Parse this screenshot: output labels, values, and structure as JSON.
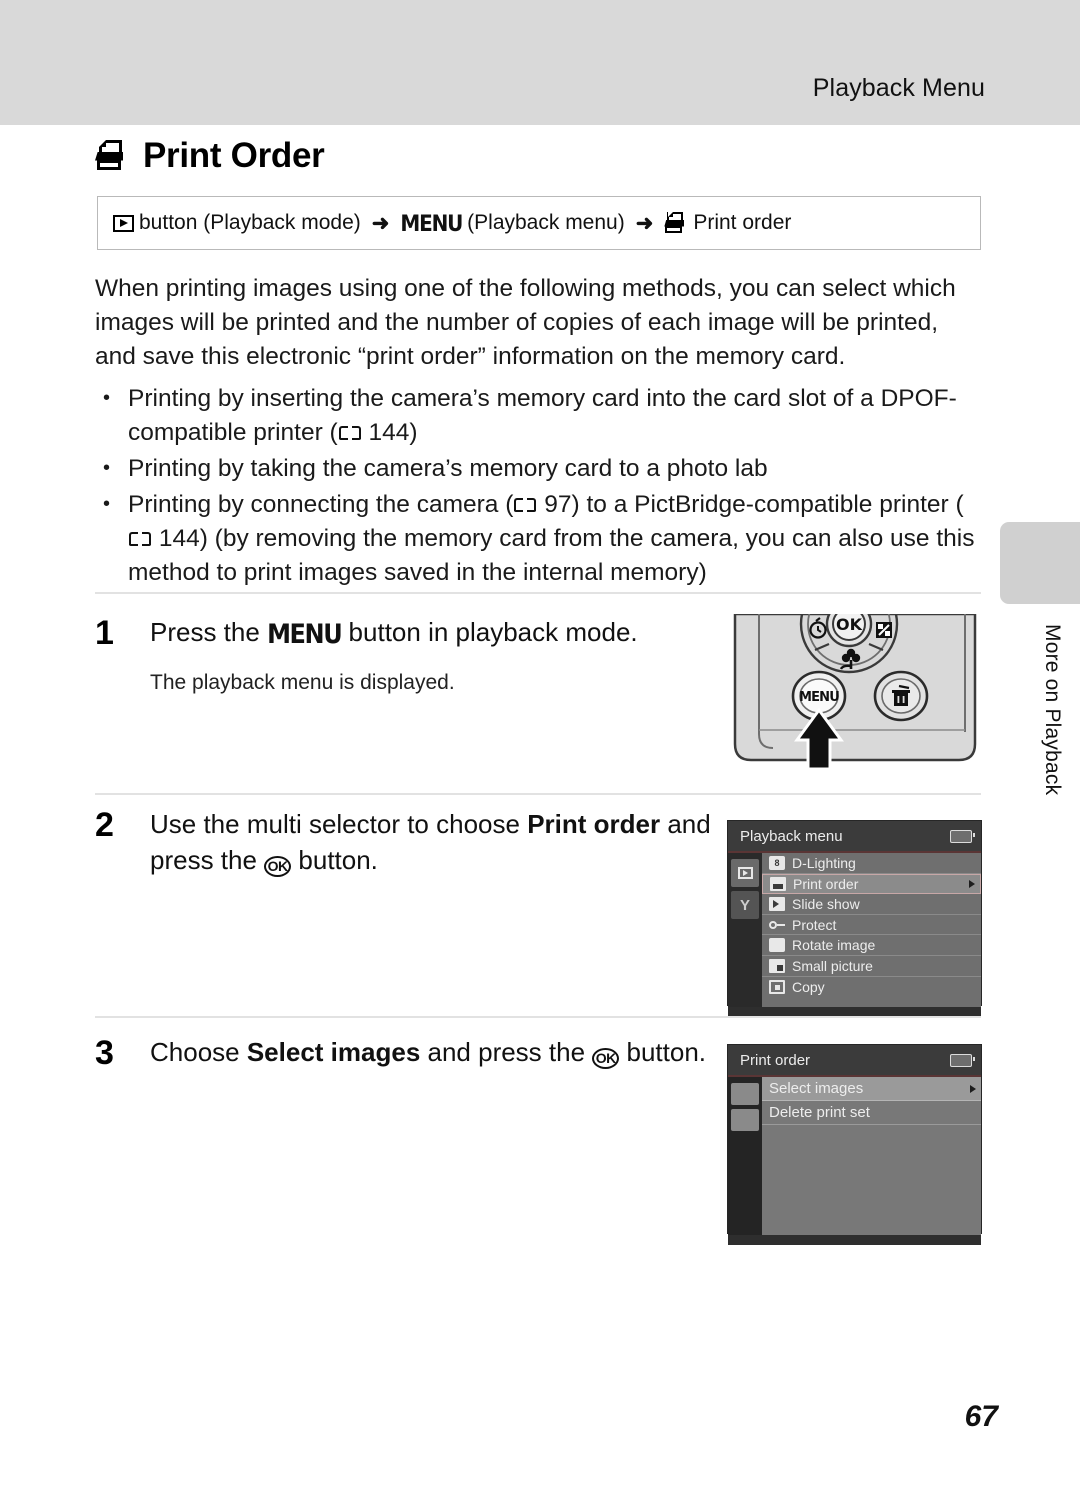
{
  "header": {
    "running_title": "Playback Menu"
  },
  "section": {
    "icon": "printer-icon",
    "title": "Print Order"
  },
  "path_box": {
    "play_icon": "playback-button-icon",
    "seg1": "button (Playback mode)",
    "arrow1": "➜",
    "menu_icon": "MENU",
    "seg2": "(Playback menu)",
    "arrow2": "➜",
    "printer_icon": "printer-icon",
    "seg3": "Print order"
  },
  "intro": {
    "paragraph": "When printing images using one of the following methods, you can select which images will be printed and the number of copies of each image will be printed, and save this electronic “print order” information on the memory card.",
    "bullets": [
      {
        "text_before": "Printing by inserting the camera’s memory card into the card slot of a DPOF-compatible printer (",
        "ref_icon": "book-icon",
        "ref_page": "144",
        "text_after": ")"
      },
      {
        "text_before": "Printing by taking the camera’s memory card to a photo lab",
        "ref_icon": "",
        "ref_page": "",
        "text_after": ""
      },
      {
        "text_before": "Printing by connecting the camera (",
        "ref_icon": "book-icon",
        "ref_page": "97",
        "text_mid": ") to a PictBridge-compatible printer (",
        "ref_icon2": "book-icon",
        "ref_page2": "144",
        "text_after": ") (by removing the memory card from the camera, you can also use this method to print images saved in the internal memory)"
      }
    ]
  },
  "steps": [
    {
      "number": "1",
      "title_before": "Press the ",
      "title_glyph": "MENU",
      "title_after": " button in playback mode.",
      "sub": "The playback menu is displayed."
    },
    {
      "number": "2",
      "title_before": "Use the multi selector to choose ",
      "title_bold": "Print order",
      "title_mid": " and press the ",
      "title_glyph": "OK",
      "title_after": " button.",
      "sub": ""
    },
    {
      "number": "3",
      "title_before": "Choose ",
      "title_bold": "Select images",
      "title_mid": " and press the ",
      "title_glyph": "OK",
      "title_after": " button.",
      "sub": ""
    }
  ],
  "camera_figure": {
    "name": "camera-rear-controls",
    "selftimer_icon": "self-timer-icon",
    "ok_label": "OK",
    "exposure_icon": "exposure-compensation-icon",
    "macro_icon": "macro-flower-icon",
    "menu_button_label": "MENU",
    "delete_icon": "trash-icon",
    "callout": "press-arrow"
  },
  "playback_menu_lcd": {
    "title": "Playback menu",
    "battery_icon": "battery-icon",
    "tabs": [
      {
        "icon": "playback-tab-icon",
        "active": true
      },
      {
        "icon": "setup-wrench-tab-icon",
        "active": false
      }
    ],
    "items": [
      {
        "icon": "d-lighting-icon",
        "label": "D-Lighting",
        "selected": false,
        "has_arrow": false
      },
      {
        "icon": "print-order-icon",
        "label": "Print order",
        "selected": true,
        "has_arrow": true
      },
      {
        "icon": "slide-show-icon",
        "label": "Slide show",
        "selected": false,
        "has_arrow": false
      },
      {
        "icon": "protect-key-icon",
        "label": "Protect",
        "selected": false,
        "has_arrow": false
      },
      {
        "icon": "rotate-image-icon",
        "label": "Rotate image",
        "selected": false,
        "has_arrow": false
      },
      {
        "icon": "small-picture-icon",
        "label": "Small picture",
        "selected": false,
        "has_arrow": false
      },
      {
        "icon": "copy-icon",
        "label": "Copy",
        "selected": false,
        "has_arrow": false
      }
    ]
  },
  "print_order_lcd": {
    "title": "Print order",
    "battery_icon": "battery-icon",
    "items": [
      {
        "label": "Select images",
        "selected": true,
        "has_arrow": true
      },
      {
        "label": "Delete print set",
        "selected": false,
        "has_arrow": false
      }
    ]
  },
  "side_tab": {
    "label": "More on Playback"
  },
  "footer": {
    "page_number": "67"
  }
}
